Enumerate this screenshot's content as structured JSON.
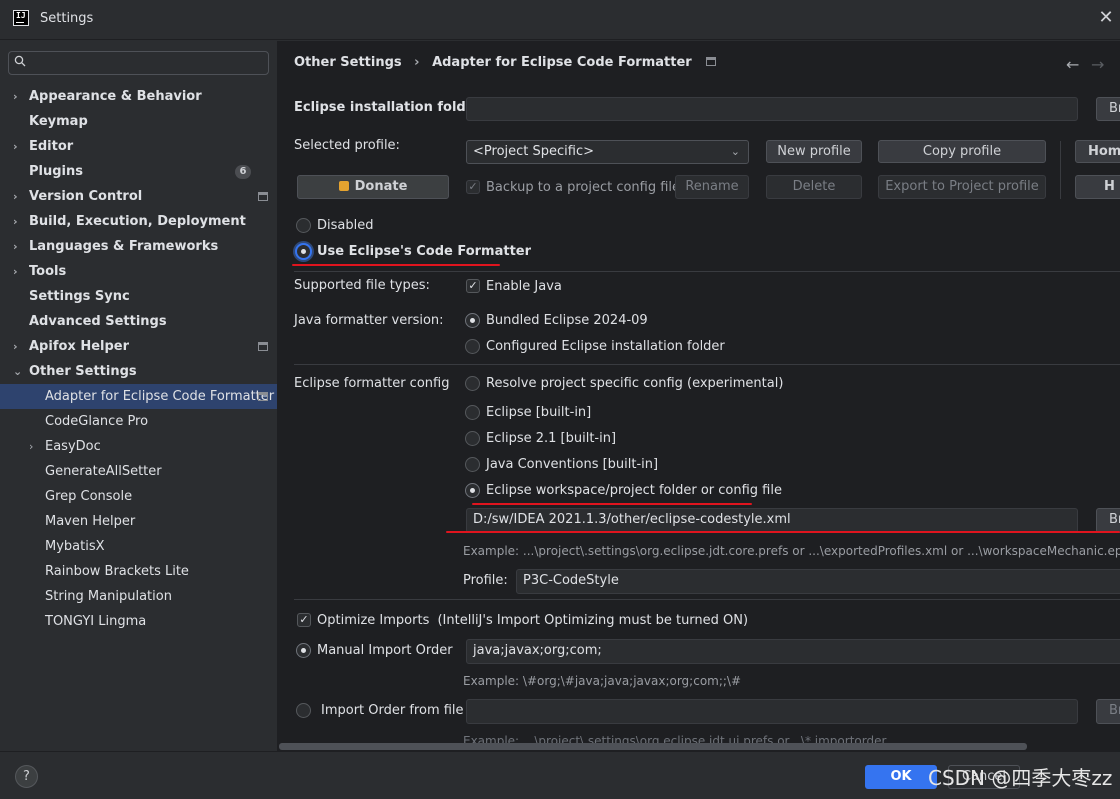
{
  "window": {
    "title": "Settings"
  },
  "search": {
    "placeholder": ""
  },
  "sidebar": {
    "items": [
      {
        "label": "Appearance & Behavior",
        "chevron": "›"
      },
      {
        "label": "Keymap"
      },
      {
        "label": "Editor",
        "chevron": "›"
      },
      {
        "label": "Plugins",
        "badge": "6"
      },
      {
        "label": "Version Control",
        "chevron": "›"
      },
      {
        "label": "Build, Execution, Deployment",
        "chevron": "›"
      },
      {
        "label": "Languages & Frameworks",
        "chevron": "›"
      },
      {
        "label": "Tools",
        "chevron": "›"
      },
      {
        "label": "Settings Sync"
      },
      {
        "label": "Advanced Settings"
      },
      {
        "label": "Apifox Helper",
        "chevron": "›"
      },
      {
        "label": "Other Settings",
        "chevron": "⌄"
      }
    ],
    "children": [
      {
        "label": "Adapter for Eclipse Code Formatter"
      },
      {
        "label": "CodeGlance Pro"
      },
      {
        "label": "EasyDoc",
        "chevron": "›"
      },
      {
        "label": "GenerateAllSetter"
      },
      {
        "label": "Grep Console"
      },
      {
        "label": "Maven Helper"
      },
      {
        "label": "MybatisX"
      },
      {
        "label": "Rainbow Brackets Lite"
      },
      {
        "label": "String Manipulation"
      },
      {
        "label": "TONGYI Lingma"
      }
    ]
  },
  "breadcrumb": {
    "parent": "Other Settings",
    "separator": "›",
    "current": "Adapter for Eclipse Code Formatter"
  },
  "nav": {
    "back": "←",
    "forward": "→"
  },
  "main": {
    "install_folder_label": "Eclipse installation folder",
    "install_folder_value": "",
    "browse_label": "Br",
    "selected_profile_label": "Selected profile:",
    "profile_select_value": "<Project Specific>",
    "new_profile": "New profile",
    "copy_profile": "Copy profile",
    "home_label": "Hom",
    "donate": "Donate",
    "backup_label": "Backup to a project config file",
    "rename": "Rename",
    "delete": "Delete",
    "export_profile": "Export to Project profile",
    "h_label": "H",
    "disabled_label": "Disabled",
    "use_eclipse_label": "Use Eclipse's Code Formatter",
    "supported_types_label": "Supported file types:",
    "enable_java": "Enable Java",
    "java_version_label": "Java formatter version:",
    "bundled_eclipse": "Bundled Eclipse 2024-09",
    "configured_folder": "Configured Eclipse installation folder",
    "formatter_config_label": "Eclipse formatter config",
    "opt_resolve": "Resolve project specific config (experimental)",
    "opt_builtin": "Eclipse [built-in]",
    "opt_builtin21": "Eclipse 2.1 [built-in]",
    "opt_java_conv": "Java Conventions [built-in]",
    "opt_workspace": "Eclipse workspace/project folder or config file",
    "config_path": "D:/sw/IDEA 2021.1.3/other/eclipse-codestyle.xml",
    "config_example": "Example: ...\\project\\.settings\\org.eclipse.jdt.core.prefs or ...\\exportedProfiles.xml or ...\\workspaceMechanic.epf",
    "profile_label": "Profile:",
    "profile_value": "P3C-CodeStyle",
    "optimize_imports": "Optimize Imports",
    "optimize_note": "(IntelliJ's Import Optimizing must be turned ON)",
    "manual_import_label": "Manual Import Order",
    "manual_import_value": "java;javax;org;com;",
    "import_example": "Example: \\#org;\\#java;java;javax;org;com;;\\#",
    "import_from_file_label": "Import Order from file",
    "import_file_example": "Example: ...\\project\\.settings\\org.eclipse.jdt.ui.prefs or ..\\*.importorder"
  },
  "footer": {
    "ok": "OK",
    "cancel": "Cancel",
    "help": "?"
  },
  "watermark": "CSDN @四季大枣zz",
  "colors": {
    "accent": "#3574f0",
    "selection": "#2e436e",
    "annotation_red": "#e0141e"
  }
}
